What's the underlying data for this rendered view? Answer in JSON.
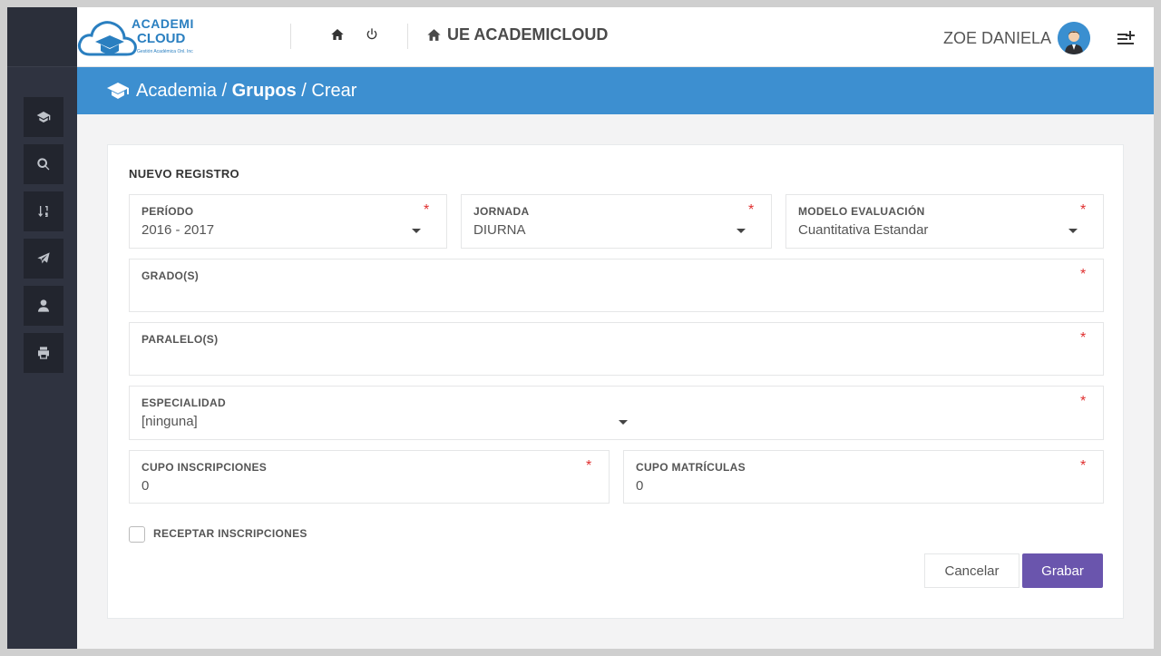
{
  "app": {
    "logo_line1": "ACADEMI",
    "logo_line2": "CLOUD",
    "logo_tagline": "Gestión Académica Onl. Inc",
    "school_name": "UE ACADEMICLOUD",
    "user_name": "ZOE DANIELA"
  },
  "sidebar": {
    "items": [
      {
        "icon": "graduation-cap-icon"
      },
      {
        "icon": "search-icon"
      },
      {
        "icon": "sort-numeric-icon"
      },
      {
        "icon": "paper-plane-icon"
      },
      {
        "icon": "user-icon"
      },
      {
        "icon": "print-icon"
      }
    ]
  },
  "breadcrumb": {
    "part1": "Academia",
    "sep1": " / ",
    "part2": "Grupos",
    "sep2": " / ",
    "part3": "Crear"
  },
  "form": {
    "title": "NUEVO REGISTRO",
    "required_mark": "*",
    "periodo": {
      "label": "PERÍODO",
      "value": "2016 - 2017"
    },
    "jornada": {
      "label": "JORNADA",
      "value": "DIURNA"
    },
    "modelo": {
      "label": "MODELO EVALUACIÓN",
      "value": "Cuantitativa Estandar"
    },
    "grados": {
      "label": "GRADO(S)",
      "value": ""
    },
    "paralelos": {
      "label": "PARALELO(S)",
      "value": ""
    },
    "especialidad": {
      "label": "ESPECIALIDAD",
      "value": "[ninguna]"
    },
    "cupo_inscripciones": {
      "label": "CUPO INSCRIPCIONES",
      "value": "0"
    },
    "cupo_matriculas": {
      "label": "CUPO MATRÍCULAS",
      "value": "0"
    },
    "receptar": {
      "label": "RECEPTAR INSCRIPCIONES",
      "checked": false
    }
  },
  "actions": {
    "cancel_label": "Cancelar",
    "save_label": "Grabar"
  },
  "colors": {
    "sidebar": "#2f3340",
    "breadcrumb_bar": "#3d8fd0",
    "save_button": "#6a55ad",
    "required": "#e02f2f"
  }
}
